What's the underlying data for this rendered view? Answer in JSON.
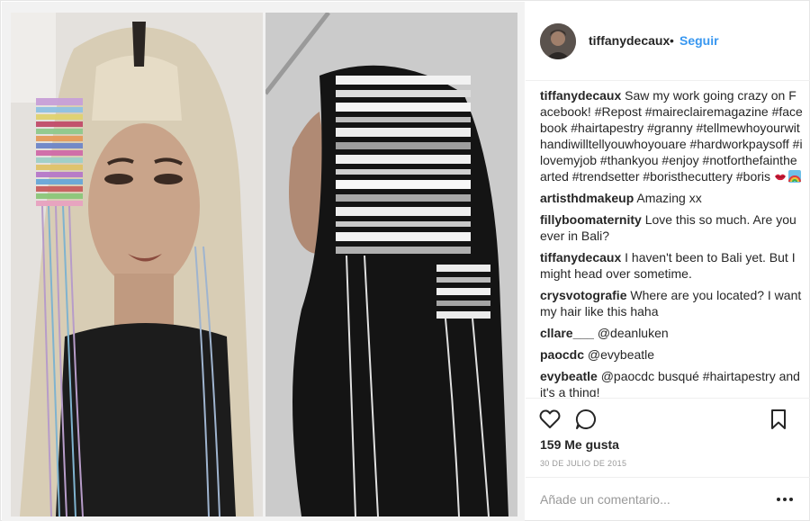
{
  "post": {
    "username": "tiffanydecaux",
    "separator": "•",
    "follow_label": "Seguir",
    "caption": {
      "user": "tiffanydecaux",
      "text": "Saw my work going crazy on Facebook! #Repost #maireclairemagazine #facebook #hairtapestry #granny #tellmewhoyourwithandiwilltellyouwhoyouare #hardworkpaysoff #ilovemyjob #thankyou #enjoy #notforthefainthearted #trendsetter #boristhecuttery #boris",
      "emojis": [
        "kiss-mark-emoji",
        "rainbow-emoji"
      ]
    },
    "comments": [
      {
        "user": "artisthdmakeup",
        "text": "Amazing xx"
      },
      {
        "user": "fillyboomaternity",
        "text": "Love this so much. Are you ever in Bali?"
      },
      {
        "user": "tiffanydecaux",
        "text": "I haven't been to Bali yet. But I might head over sometime."
      },
      {
        "user": "crysvotografie",
        "text": "Where are you located? I want my hair like this haha"
      },
      {
        "user": "cllare___",
        "text": "@deanluken"
      },
      {
        "user": "paocdc",
        "text": "@evybeatle"
      },
      {
        "user": "evybeatle",
        "text": "@paocdc busqué #hairtapestry and it's a thing!"
      }
    ],
    "likes": "159 Me gusta",
    "date": "30 DE JULIO DE 2015",
    "add_comment_placeholder": "Añade un comentario...",
    "icons": {
      "like": "heart-icon",
      "comment": "comment-bubble-icon",
      "save": "bookmark-icon",
      "more": "more-options-icon"
    },
    "colors": {
      "link": "#3897f0",
      "text": "#262626",
      "muted": "#999999",
      "border": "#efefef"
    }
  }
}
